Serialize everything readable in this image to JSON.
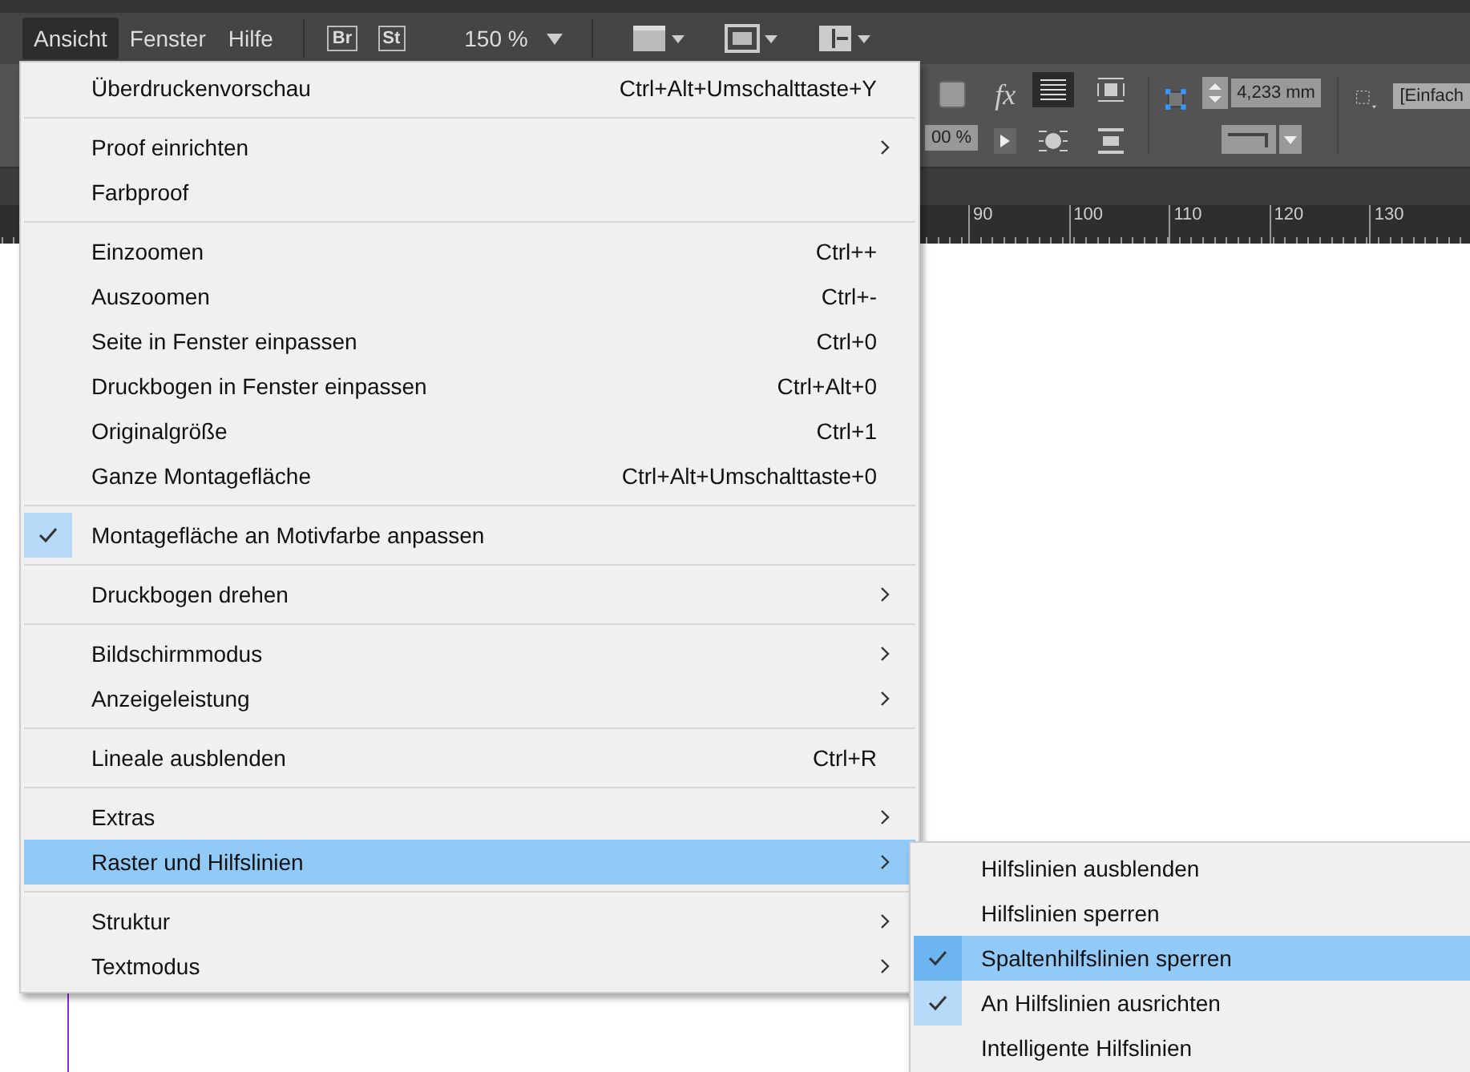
{
  "menu_bar": [
    {
      "label": "Ansicht",
      "selected": true
    },
    {
      "label": "Fenster",
      "selected": false
    },
    {
      "label": "Hilfe",
      "selected": false
    }
  ],
  "app_badges": [
    "Br",
    "St"
  ],
  "zoom": {
    "value": "150 %"
  },
  "control_panel": {
    "effects_label": "fx",
    "opacity_value": "00 %",
    "stroke_weight": "4,233 mm",
    "style_value": "[Einfach"
  },
  "ruler": {
    "labels": [
      "90",
      "100",
      "110",
      "120",
      "130"
    ]
  },
  "menu": {
    "groups": [
      [
        {
          "label": "Überdruckenvorschau",
          "shortcut": "Ctrl+Alt+Umschalttaste+Y",
          "submenu": false,
          "checked": false,
          "selected": false
        }
      ],
      [
        {
          "label": "Proof einrichten",
          "submenu": true,
          "checked": false,
          "selected": false
        },
        {
          "label": "Farbproof",
          "submenu": false,
          "checked": false,
          "selected": false
        }
      ],
      [
        {
          "label": "Einzoomen",
          "shortcut": "Ctrl++",
          "submenu": false,
          "checked": false,
          "selected": false
        },
        {
          "label": "Auszoomen",
          "shortcut": "Ctrl+-",
          "submenu": false,
          "checked": false,
          "selected": false
        },
        {
          "label": "Seite in Fenster einpassen",
          "shortcut": "Ctrl+0",
          "submenu": false,
          "checked": false,
          "selected": false
        },
        {
          "label": "Druckbogen in Fenster einpassen",
          "shortcut": "Ctrl+Alt+0",
          "submenu": false,
          "checked": false,
          "selected": false
        },
        {
          "label": "Originalgröße",
          "shortcut": "Ctrl+1",
          "submenu": false,
          "checked": false,
          "selected": false
        },
        {
          "label": "Ganze Montagefläche",
          "shortcut": "Ctrl+Alt+Umschalttaste+0",
          "submenu": false,
          "checked": false,
          "selected": false
        }
      ],
      [
        {
          "label": "Montagefläche an Motivfarbe anpassen",
          "submenu": false,
          "checked": true,
          "selected": false
        }
      ],
      [
        {
          "label": "Druckbogen drehen",
          "submenu": true,
          "checked": false,
          "selected": false
        }
      ],
      [
        {
          "label": "Bildschirmmodus",
          "submenu": true,
          "checked": false,
          "selected": false
        },
        {
          "label": "Anzeigeleistung",
          "submenu": true,
          "checked": false,
          "selected": false
        }
      ],
      [
        {
          "label": "Lineale ausblenden",
          "shortcut": "Ctrl+R",
          "submenu": false,
          "checked": false,
          "selected": false
        }
      ],
      [
        {
          "label": "Extras",
          "submenu": true,
          "checked": false,
          "selected": false
        },
        {
          "label": "Raster und Hilfslinien",
          "submenu": true,
          "checked": false,
          "selected": true
        }
      ],
      [
        {
          "label": "Struktur",
          "submenu": true,
          "checked": false,
          "selected": false
        },
        {
          "label": "Textmodus",
          "submenu": true,
          "checked": false,
          "selected": false
        }
      ]
    ]
  },
  "submenu": {
    "items": [
      {
        "label": "Hilfslinien ausblenden",
        "checked": false,
        "selected": false
      },
      {
        "label": "Hilfslinien sperren",
        "checked": false,
        "selected": false
      },
      {
        "label": "Spaltenhilfslinien sperren",
        "checked": true,
        "selected": true
      },
      {
        "label": "An Hilfslinien ausrichten",
        "checked": true,
        "selected": false
      },
      {
        "label": "Intelligente Hilfslinien",
        "checked": false,
        "selected": false
      }
    ]
  }
}
